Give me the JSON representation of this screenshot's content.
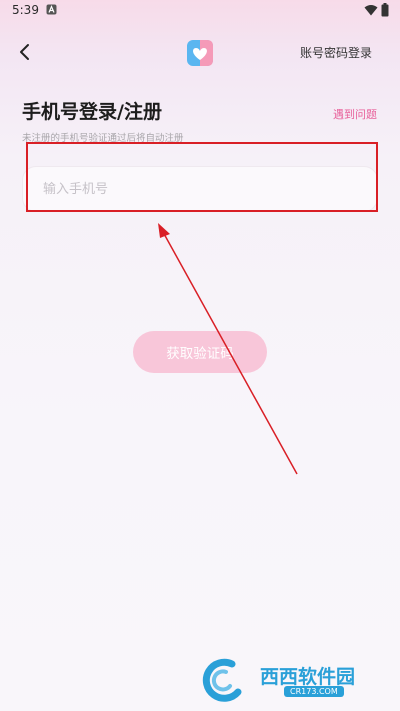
{
  "status_bar": {
    "time": "5:39",
    "notification_icon": "a-letter-icon",
    "wifi_icon": "wifi-icon",
    "battery_icon": "battery-icon"
  },
  "header": {
    "back_icon": "chevron-left-icon",
    "logo_icon": "heart-logo-icon",
    "account_login_label": "账号密码登录"
  },
  "login": {
    "title": "手机号登录/注册",
    "subtitle": "未注册的手机号验证通过后将自动注册",
    "problem_link": "遇到问题",
    "phone_placeholder": "输入手机号",
    "phone_value": "",
    "get_code_label": "获取验证码"
  },
  "watermark": {
    "brand": "西西软件园",
    "domain": "CR173.COM"
  },
  "colors": {
    "accent_pink": "#e8609a",
    "button_pink": "#f8c6d9",
    "annotation_red": "#d91f26"
  }
}
